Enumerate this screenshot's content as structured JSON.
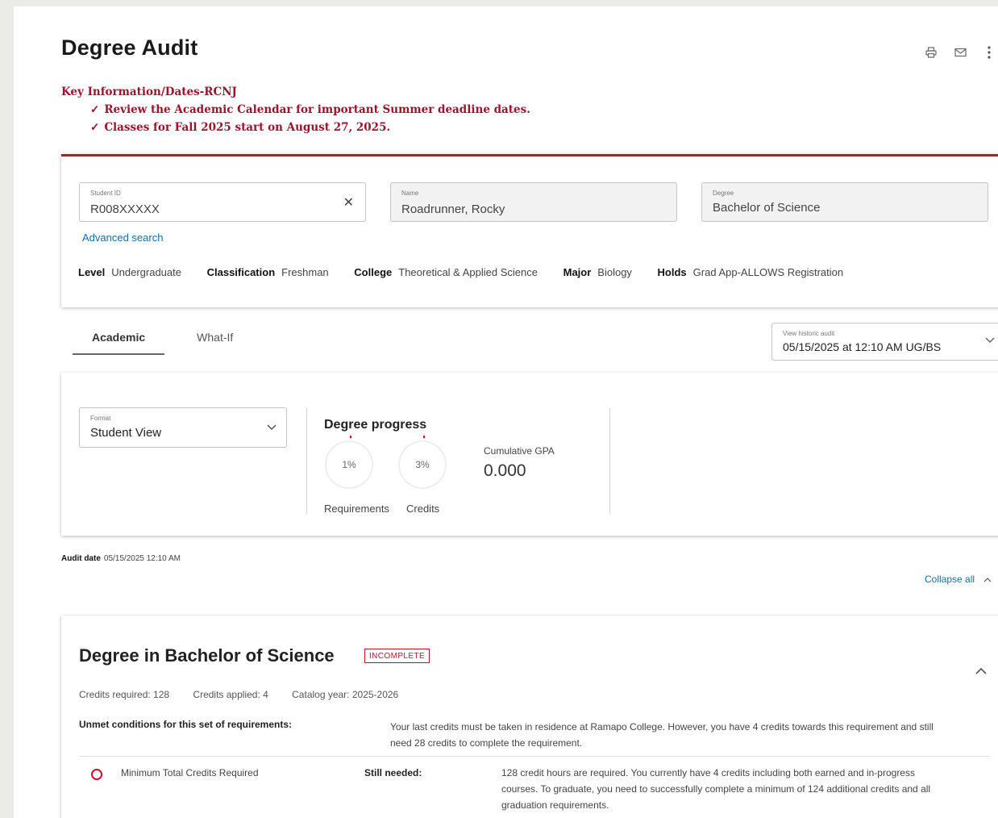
{
  "page": {
    "title": "Degree Audit"
  },
  "key_info": {
    "heading": "Key Information/Dates-RCNJ",
    "lines": [
      "Review the Academic Calendar for important Summer deadline dates.",
      "Classes for Fall 2025 start on August 27, 2025."
    ],
    "check_glyph": "✓"
  },
  "student": {
    "student_id_label": "Student ID",
    "student_id_value": "R008XXXXX",
    "name_label": "Name",
    "name_value": "Roadrunner, Rocky",
    "degree_label": "Degree",
    "degree_value": "Bachelor of Science",
    "advanced_search": "Advanced search",
    "meta": [
      {
        "label": "Level",
        "value": "Undergraduate"
      },
      {
        "label": "Classification",
        "value": "Freshman"
      },
      {
        "label": "College",
        "value": "Theoretical & Applied Science"
      },
      {
        "label": "Major",
        "value": "Biology"
      },
      {
        "label": "Holds",
        "value": "Grad App-ALLOWS Registration"
      }
    ]
  },
  "tabs": [
    {
      "label": "Academic",
      "active": true
    },
    {
      "label": "What-If",
      "active": false
    }
  ],
  "historic_audit": {
    "label": "View historic audit",
    "value": "05/15/2025 at 12:10 AM UG/BS"
  },
  "format": {
    "label": "Format",
    "value": "Student View"
  },
  "degree_progress": {
    "title": "Degree progress",
    "requirements_pct": "1%",
    "credits_pct": "3%",
    "requirements_label": "Requirements",
    "credits_label": "Credits",
    "gpa_label": "Cumulative GPA",
    "gpa_value": "0.000"
  },
  "audit": {
    "date_label": "Audit date",
    "date_value": "05/15/2025 12:10 AM",
    "collapse_all": "Collapse all"
  },
  "degree_block": {
    "title": "Degree in Bachelor of Science",
    "status": "INCOMPLETE",
    "credits_required": "Credits required:  128",
    "credits_applied": "Credits applied:  4",
    "catalog_year": "Catalog year:  2025-2026",
    "unmet_label": "Unmet conditions for this set of requirements:",
    "unmet_text": "Your last credits must be taken in residence at Ramapo College. However, you have 4 credits towards this requirement and still need 28 credits to complete the requirement.",
    "req_name": "Minimum Total Credits Required",
    "still_needed_label": "Still needed:",
    "still_needed_text": "128 credit hours are required. You currently have 4 credits including both earned and in-progress courses. To graduate, you need to successfully complete a minimum of 124 additional credits and all graduation requirements."
  },
  "colors": {
    "accent": "#c8102e",
    "link": "#1a6aa8",
    "key_info": "#a0112c"
  },
  "icons": [
    "print-icon",
    "email-icon",
    "more-vertical-icon",
    "close-icon",
    "chevron-down-icon",
    "chevron-up-icon",
    "check-icon"
  ]
}
